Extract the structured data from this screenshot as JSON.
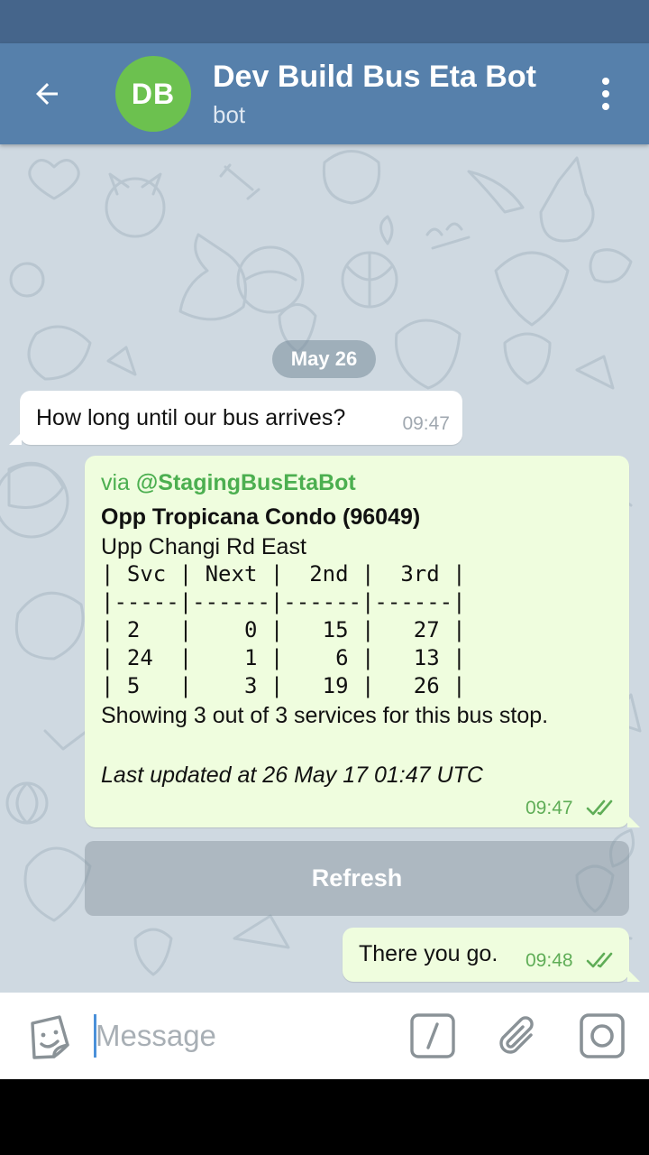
{
  "header": {
    "avatar_initials": "DB",
    "title": "Dev Build Bus Eta Bot",
    "subtitle": "bot",
    "avatar_color": "#6cc14f",
    "bar_color": "#5680ab"
  },
  "chat": {
    "date_separator": "May 26",
    "messages": [
      {
        "type": "incoming",
        "text": "How long until our bus arrives?",
        "time": "09:47"
      },
      {
        "type": "outgoing",
        "via_prefix": "via",
        "via_bot": "@StagingBusEtaBot",
        "stop_name": "Opp Tropicana Condo (96049)",
        "road": "Upp Changi Rd East",
        "table_lines": [
          "| Svc | Next |  2nd |  3rd |",
          "|-----|------|------|------|",
          "| 2   |    0 |   15 |   27 |",
          "| 24  |    1 |    6 |   13 |",
          "| 5   |    3 |   19 |   26 |"
        ],
        "summary": "Showing 3 out of 3 services for this bus stop.",
        "updated": "Last updated at 26 May 17 01:47 UTC",
        "time": "09:47",
        "status": "read"
      },
      {
        "type": "outgoing",
        "text": "There you go.",
        "time": "09:48",
        "status": "read"
      }
    ],
    "inline_button": "Refresh"
  },
  "input": {
    "placeholder": "Message",
    "icons": [
      "sticker-icon",
      "bot-command-icon",
      "paperclip-icon",
      "camera-icon"
    ]
  },
  "colors": {
    "outgoing_bubble": "#effdde",
    "incoming_bubble": "#ffffff",
    "read_check": "#5fad57"
  }
}
